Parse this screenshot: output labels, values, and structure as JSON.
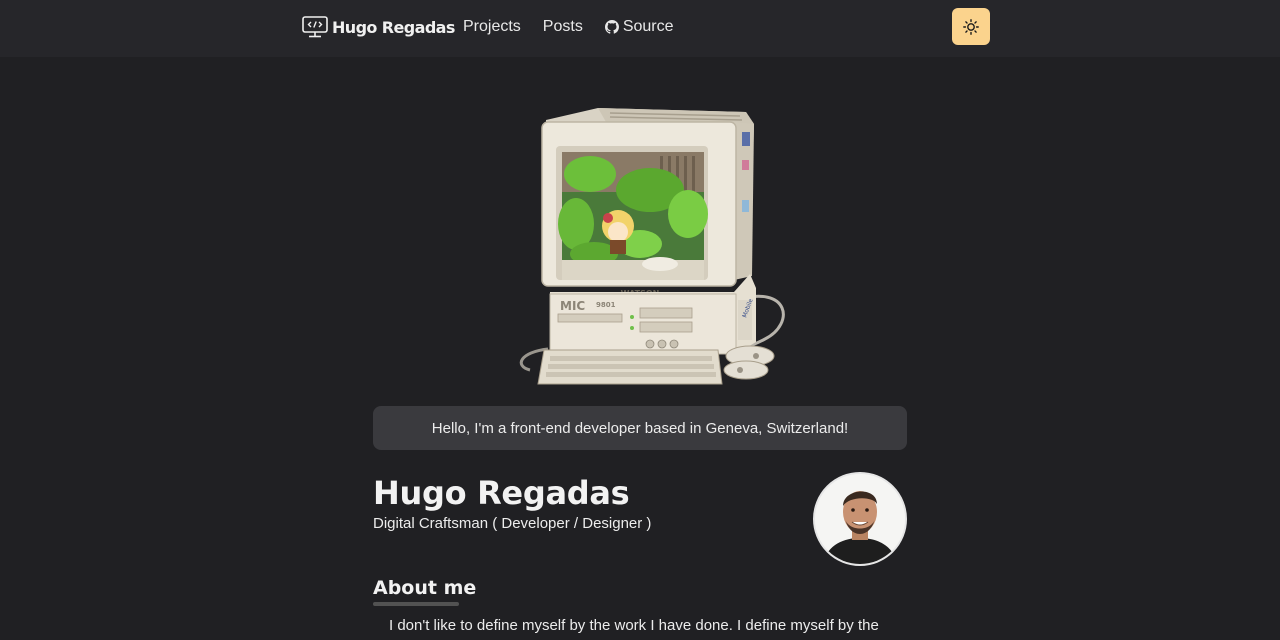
{
  "nav": {
    "logo_text": "Hugo Regadas",
    "links": [
      {
        "label": "Projects"
      },
      {
        "label": "Posts"
      },
      {
        "label": "Source",
        "icon": "github-icon"
      }
    ],
    "theme_toggle_icon": "sun-icon",
    "theme_toggle_color": "#fbd38d"
  },
  "hero": {
    "image_icon": "retro-computer-illustration",
    "computer_brand": "WATSON",
    "computer_model": "9801"
  },
  "intro": {
    "text": "Hello, I'm a front-end developer based in Geneva, Switzerland!"
  },
  "profile": {
    "name": "Hugo Regadas",
    "subtitle": "Digital Craftsman ( Developer / Designer )",
    "avatar_icon": "profile-photo"
  },
  "about": {
    "title": "About me",
    "text": "I don't like to define myself by the work I have done. I define myself by the"
  },
  "colors": {
    "background": "#202023",
    "navbar": "#26262a",
    "intro_box": "#3a3a3e",
    "accent": "#fbd38d"
  }
}
